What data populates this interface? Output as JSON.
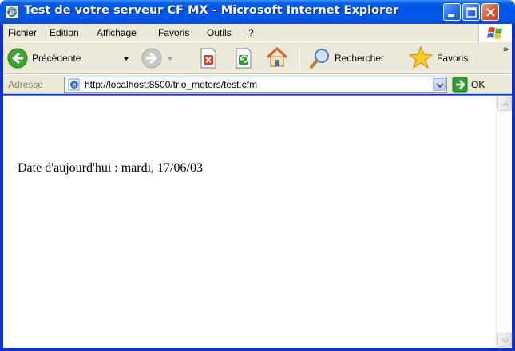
{
  "window": {
    "title": "Test de votre serveur CF MX - Microsoft Internet Explorer"
  },
  "menu": {
    "items": [
      {
        "label_u": "F",
        "label_rest": "ichier"
      },
      {
        "label_u": "E",
        "label_rest": "dition"
      },
      {
        "label_u": "A",
        "label_rest": "ffichage"
      },
      {
        "label_pre": "Fa",
        "label_u": "v",
        "label_rest": "oris"
      },
      {
        "label_u": "O",
        "label_rest": "utils"
      },
      {
        "label_u": "?",
        "label_rest": ""
      }
    ]
  },
  "toolbar": {
    "back_label": "Précédente",
    "search_label": "Rechercher",
    "favorites_label": "Favoris",
    "more": "»"
  },
  "address": {
    "label_pre": "A",
    "label_u": "d",
    "label_rest": "resse",
    "url": "http://localhost:8500/trio_motors/test.cfm",
    "go_label": "OK"
  },
  "page": {
    "text": "Date d'aujourd'hui : mardi, 17/06/03"
  },
  "colors": {
    "titlebar": "#0058ee",
    "chrome": "#ece9d8",
    "close": "#e05a30"
  },
  "icons": {
    "app": "ie-icon",
    "back": "back-arrow-icon",
    "forward": "forward-arrow-icon",
    "stop": "stop-icon",
    "refresh": "refresh-icon",
    "home": "home-icon",
    "search": "magnifier-icon",
    "favorites": "star-icon",
    "go": "go-arrow-icon"
  }
}
